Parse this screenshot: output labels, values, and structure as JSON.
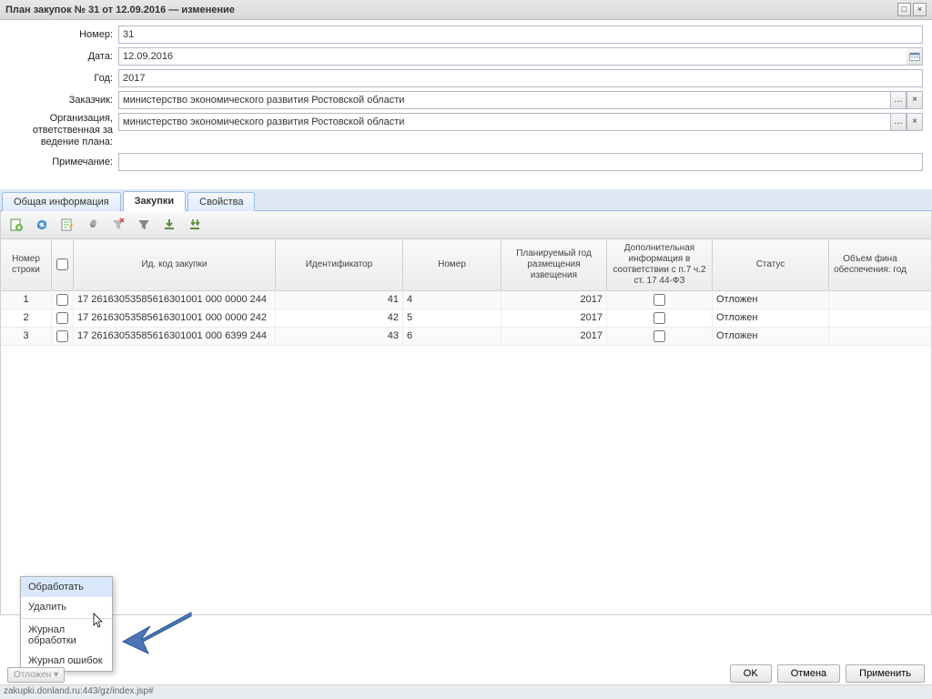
{
  "window": {
    "title": "План закупок № 31 от 12.09.2016 — изменение"
  },
  "form": {
    "number_label": "Номер:",
    "number_value": "31",
    "date_label": "Дата:",
    "date_value": "12.09.2016",
    "year_label": "Год:",
    "year_value": "2017",
    "customer_label": "Заказчик:",
    "customer_value": "министерство экономического развития Ростовской области",
    "org_label": "Организация, ответственная за ведение плана:",
    "org_value": "министерство экономического развития Ростовской области",
    "note_label": "Примечание:",
    "note_value": ""
  },
  "tabs": {
    "t0": "Общая информация",
    "t1": "Закупки",
    "t2": "Свойства"
  },
  "grid": {
    "headers": {
      "rownum": "Номер строки",
      "id": "Ид. код закупки",
      "ident": "Идентификатор",
      "num": "Номер",
      "year": "Планируемый год размещения извещения",
      "extra": "Дополнительная информация в соответствии с п.7 ч.2 ст. 17 44-ФЗ",
      "status": "Статус",
      "fin": "Объем фина обеспечения: год"
    },
    "rows": [
      {
        "n": "1",
        "id": "17 26163053585616301001 000 0000 244",
        "ident": "41",
        "num": "4",
        "year": "2017",
        "status": "Отложен"
      },
      {
        "n": "2",
        "id": "17 26163053585616301001 000 0000 242",
        "ident": "42",
        "num": "5",
        "year": "2017",
        "status": "Отложен"
      },
      {
        "n": "3",
        "id": "17 26163053585616301001 000 6399 244",
        "ident": "43",
        "num": "6",
        "year": "2017",
        "status": "Отложен"
      }
    ]
  },
  "menu": {
    "process": "Обработать",
    "delete": "Удалить",
    "log_process": "Журнал обработки",
    "log_errors": "Журнал ошибок"
  },
  "footer": {
    "ok": "OK",
    "cancel": "Отмена",
    "apply": "Применить",
    "status_split": "Отложен ▾"
  },
  "statusbar": "zakupki.donland.ru:443/gz/index.jsp#"
}
